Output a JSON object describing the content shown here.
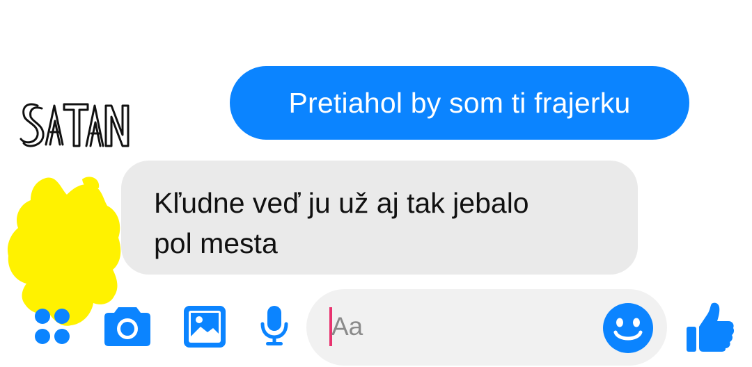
{
  "sender_label": "SATAN",
  "messages": {
    "outgoing": "Pretiahol by som ti frajerku",
    "incoming_line1": "Kľudne veď ju už aj tak jebalo",
    "incoming_line2": "pol mesta"
  },
  "composer": {
    "placeholder": "Aa"
  },
  "icons": {
    "apps": "apps-grid-icon",
    "camera": "camera-icon",
    "gallery": "image-icon",
    "voice": "microphone-icon",
    "emoji": "smiley-icon",
    "like": "thumbs-up-icon"
  },
  "colors": {
    "accent": "#0b84ff",
    "outgoing_bubble": "#0b84ff",
    "incoming_bubble": "#eaeaea",
    "composer_bg": "#f1f1f1",
    "caret": "#e8336f",
    "redaction": "#fff200"
  }
}
